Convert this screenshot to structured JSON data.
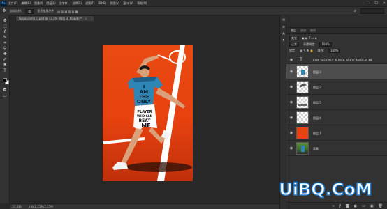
{
  "menubar": {
    "logo_text": "Ps",
    "menu_items": [
      "文件(F)",
      "编辑(E)",
      "图像(I)",
      "图层(L)",
      "文字(Y)",
      "选择(S)",
      "滤镜(T)",
      "3D(D)",
      "视图(V)",
      "窗口(W)",
      "帮助(H)"
    ],
    "window_controls": [
      "—",
      "☐",
      "✕"
    ]
  },
  "options_bar": {
    "tool_icon": "move-tool-icon",
    "items": [
      "自动选择:",
      "组",
      "显示变换控件"
    ],
    "workspace_label": ""
  },
  "document_tab": {
    "title": "tulips.com.(1).psd @ 33.3% (图层 3, RGB/8) *",
    "close": "×"
  },
  "status_bar": {
    "zoom": "33.33%",
    "doc_info": "文档:2.25M/2.25M"
  },
  "layers_panel": {
    "tabs": [
      "图层",
      "通道",
      "路径"
    ],
    "filter_label": "类型",
    "blend_mode": "正常",
    "opacity_label": "不透明度:",
    "opacity_value": "100%",
    "lock_label": "锁定:",
    "fill_label": "填充:",
    "fill_value": "100%",
    "layers": [
      {
        "name": "I AM THE ONLY PLAYER WHO CAN BEAT ME",
        "kind": "text",
        "visible": true,
        "selected": false
      },
      {
        "name": "图层 3",
        "kind": "pixel",
        "visible": true,
        "selected": true
      },
      {
        "name": "图层 2",
        "kind": "pixel",
        "visible": true,
        "selected": false
      },
      {
        "name": "图层 5",
        "kind": "pixel",
        "visible": true,
        "selected": false
      },
      {
        "name": "图层 4",
        "kind": "pixel",
        "visible": true,
        "selected": false
      },
      {
        "name": "图层 1",
        "kind": "fill",
        "visible": true,
        "selected": false
      },
      {
        "name": "背景",
        "kind": "photo",
        "visible": true,
        "selected": false
      }
    ],
    "footer_icons": [
      "link-icon",
      "fx-icon",
      "mask-icon",
      "adjustment-icon",
      "folder-icon",
      "new-layer-icon",
      "trash-icon"
    ]
  },
  "artwork": {
    "shirt_text": [
      "I",
      "AM",
      "THE",
      "ONLY"
    ],
    "shorts_text": [
      "PLAYER",
      "WHO CAN",
      "BEAT",
      "ME"
    ]
  },
  "watermark": {
    "text": "UiBQ.CoM"
  },
  "colors": {
    "app_bg": "#282828",
    "panel_bg": "#323232",
    "selected_layer": "#4d4d4d",
    "artwork_orange": "#e8440f",
    "watermark_fill": "#ffffff",
    "watermark_stroke": "#1f7fd6"
  }
}
